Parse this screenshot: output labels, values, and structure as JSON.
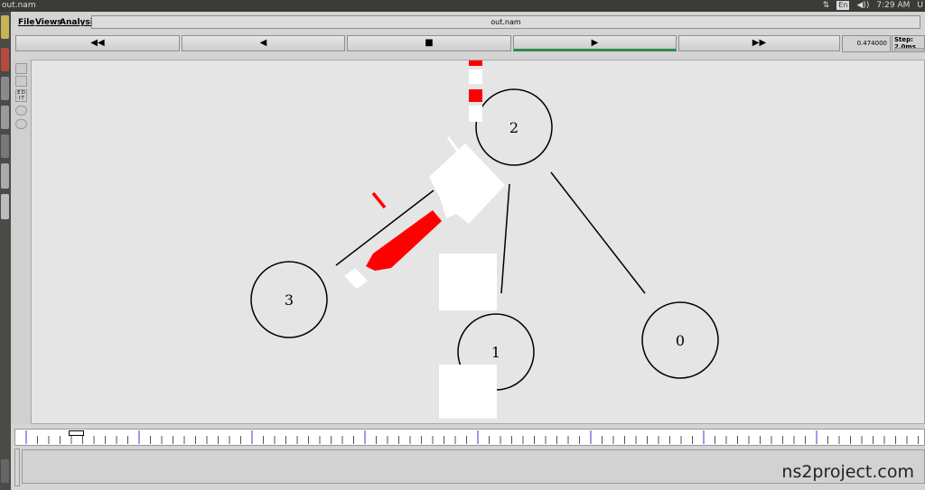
{
  "system": {
    "app_title": "out.nam",
    "lang": "En",
    "volume": "◀))",
    "time": "7:29 AM",
    "user": "U"
  },
  "menu": {
    "file": "File",
    "views": "Views",
    "analysis": "Analysis"
  },
  "window_title": "out.nam",
  "playback": {
    "rewind": "◀◀",
    "back": "◀",
    "stop": "■",
    "play": "▶",
    "fast_forward": "▶▶",
    "active": "play"
  },
  "time_display": "0.474000",
  "step_label": "Step: 2.0ms",
  "tools": {
    "edit": "E D I T"
  },
  "nodes": [
    {
      "id": "n0",
      "label": "0"
    },
    {
      "id": "n1",
      "label": "1"
    },
    {
      "id": "n2",
      "label": "2"
    },
    {
      "id": "n3",
      "label": "3"
    }
  ],
  "colors": {
    "packet_red": "#ff0000",
    "packet_white": "#ffffff",
    "play_active": "#2f8a4c"
  },
  "watermark": "ns2project.com"
}
